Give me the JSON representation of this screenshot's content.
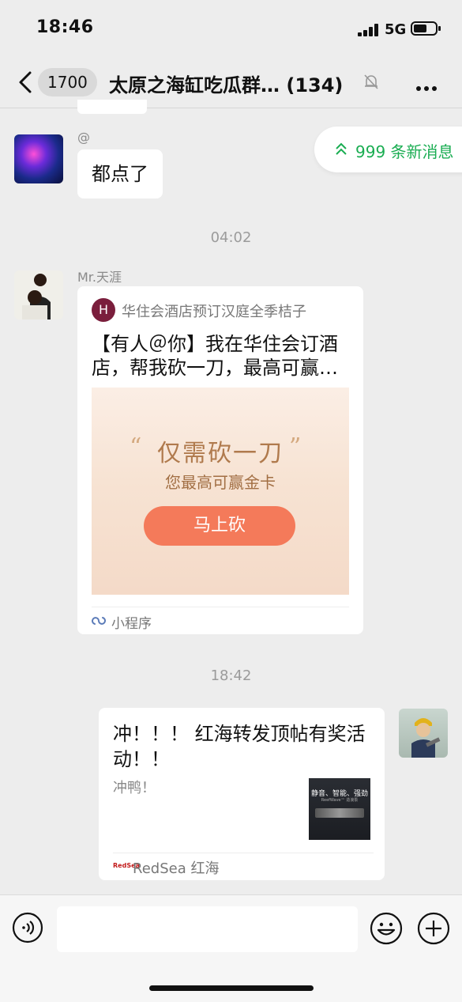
{
  "status_bar": {
    "time": "18:46",
    "network": "5G"
  },
  "nav": {
    "back_icon": "chevron-left-icon",
    "unread_count": "1700",
    "title": "太原之海缸吃瓜群… (134)",
    "mute_icon": "bell-slash-icon",
    "more_icon": "more-dots-icon"
  },
  "new_messages": {
    "label": "999 条新消息",
    "color": "#1aad52",
    "icon": "double-chevron-up-icon"
  },
  "messages": [
    {
      "sender": "@",
      "text": "都点了"
    },
    {
      "time": "04:02"
    },
    {
      "sender": "Mr.天涯",
      "mini_program": {
        "app_name": "华住会酒店预订汉庭全季桔子",
        "logo_text": "H",
        "title": "【有人＠你】我在华住会订酒店，帮我砍一刀，最高可赢…",
        "image_quote_open": "“",
        "image_quote_close": "”",
        "image_headline": "仅需砍一刀",
        "image_subline": "您最高可赢金卡",
        "image_button": "马上砍",
        "footer": "小程序"
      }
    },
    {
      "time": "18:42"
    },
    {
      "self": true,
      "link_card": {
        "title": "冲！！！ 红海转发顶帖有奖活动！！",
        "description": "冲鸭！",
        "thumb_line1": "静音、智能、强劲",
        "thumb_line2": "ReefWave™ 造浪泵",
        "source": "RedSea 红海",
        "source_logo": "RedSea"
      }
    }
  ],
  "input_bar": {
    "voice_icon": "voice-icon",
    "emoji_icon": "emoji-icon",
    "plus_icon": "plus-icon",
    "placeholder": ""
  },
  "colors": {
    "accent": "#1aad52",
    "button": "#f47a5a",
    "background": "#ededed"
  }
}
